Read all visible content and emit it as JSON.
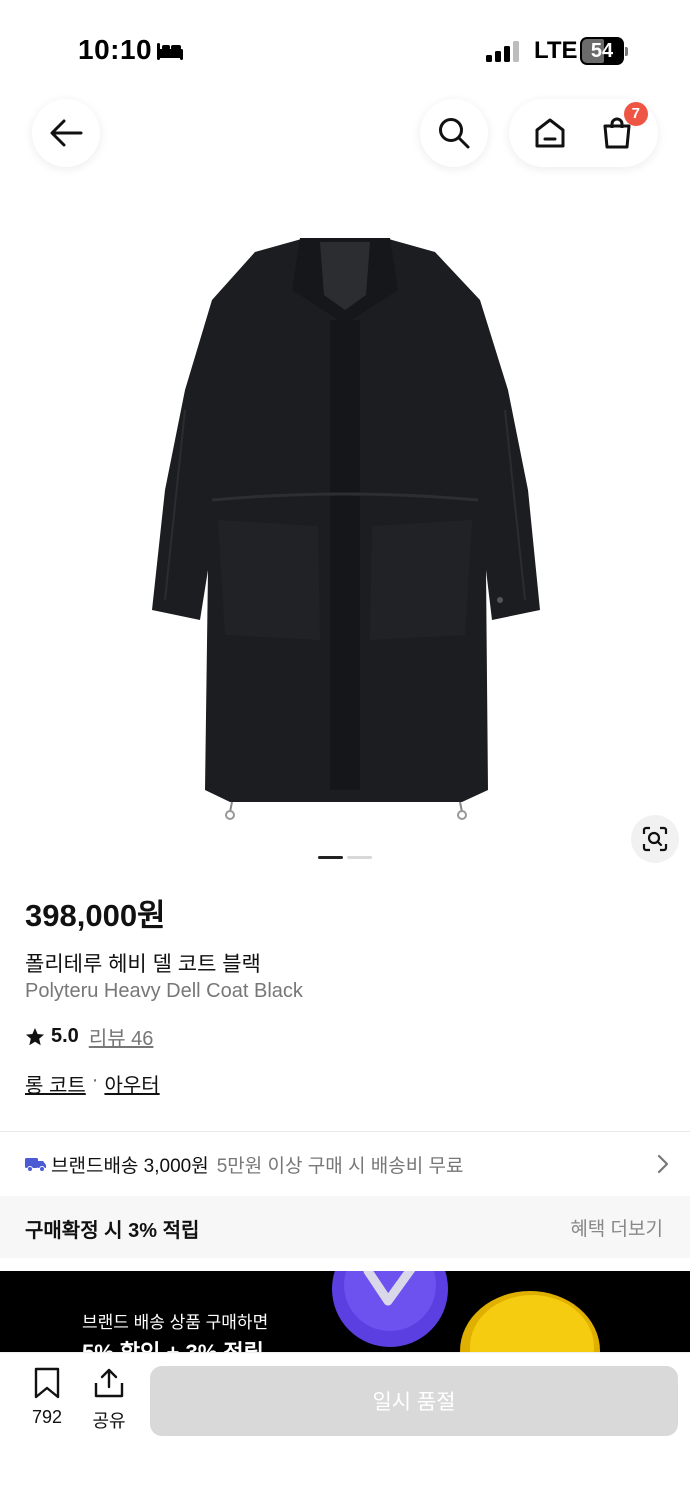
{
  "status_bar": {
    "time": "10:10",
    "network": "LTE",
    "battery": "54"
  },
  "nav": {
    "cart_count": "7"
  },
  "product": {
    "price": "398,000원",
    "name_ko": "폴리테루 헤비 델 코트 블랙",
    "name_en": "Polyteru Heavy Dell Coat Black",
    "rating": "5.0",
    "review_label": "리뷰 46",
    "categories": [
      "롱 코트",
      "아우터"
    ],
    "category_sep": "·",
    "image_pages": 2,
    "image_current": 1
  },
  "delivery": {
    "label": "브랜드배송 3,000원",
    "note": "5만원 이상 구매 시 배송비 무료"
  },
  "points": {
    "label": "구매확정 시 3% 적립",
    "more": "혜택 더보기"
  },
  "promo": {
    "line1": "브랜드 배송 상품 구매하면",
    "line2": "5% 할인 + 3% 적립"
  },
  "bottom_bar": {
    "save_count": "792",
    "share_label": "공유",
    "cta_label": "일시 품절"
  },
  "colors": {
    "badge": "#ee5545",
    "cta_disabled": "#d9d9d9",
    "delivery_truck": "#4a5bd4"
  }
}
